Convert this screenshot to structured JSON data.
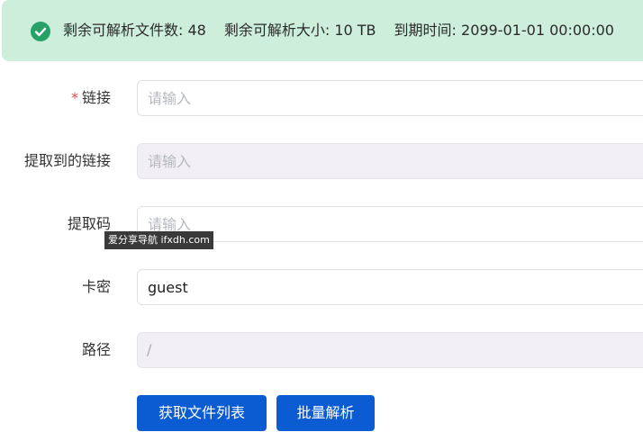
{
  "alert": {
    "icon": "check-circle-icon",
    "color": "#cdeeda",
    "icon_color": "#26a269",
    "remaining_files": "剩余可解析文件数: 48",
    "remaining_size": "剩余可解析大小: 10 TB",
    "expire_time": "到期时间: 2099-01-01 00:00:00"
  },
  "form": {
    "link": {
      "required_mark": "*",
      "label": "链接",
      "placeholder": "请输入",
      "value": ""
    },
    "extracted_link": {
      "label": "提取到的链接",
      "placeholder": "请输入",
      "value": ""
    },
    "extract_code": {
      "label": "提取码",
      "placeholder": "请输入",
      "value": ""
    },
    "card_key": {
      "label": "卡密",
      "value": "guest"
    },
    "path": {
      "label": "路径",
      "value": "/"
    }
  },
  "watermark": {
    "text": "爱分享导航 ifxdh.com"
  },
  "buttons": {
    "get_file_list": "获取文件列表",
    "batch_parse": "批量解析",
    "color": "#0b5bd3"
  }
}
